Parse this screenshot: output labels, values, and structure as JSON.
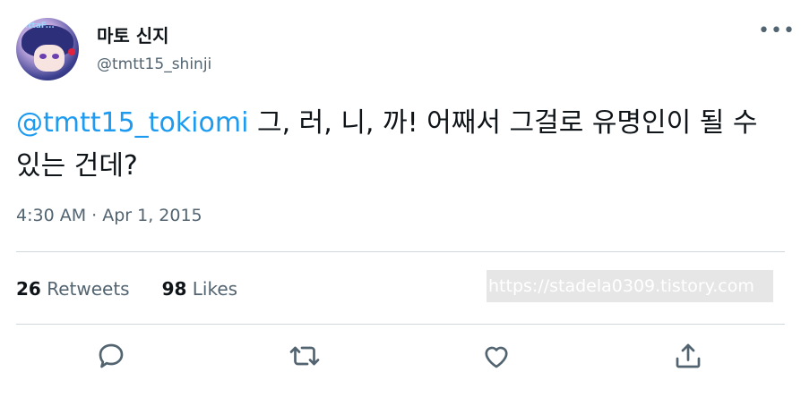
{
  "user": {
    "display_name": "마토 신지",
    "handle": "@tmtt15_shinji",
    "avatar_tag": "ittaF..."
  },
  "tweet": {
    "mention": "@tmtt15_tokiomi",
    "text": " 그, 러, 니, 까! 어째서 그걸로 유명인이 될 수 있는 건데?",
    "timestamp": "4:30 AM · Apr 1, 2015"
  },
  "stats": {
    "retweets_count": "26",
    "retweets_label": "Retweets",
    "likes_count": "98",
    "likes_label": "Likes"
  },
  "watermark": "https://stadela0309.tistory.com",
  "icons": [
    "more-icon",
    "reply-icon",
    "retweet-icon",
    "like-icon",
    "share-icon"
  ],
  "colors": {
    "link": "#1d9bf0",
    "secondary": "#536471",
    "divider": "#cfd9de"
  }
}
